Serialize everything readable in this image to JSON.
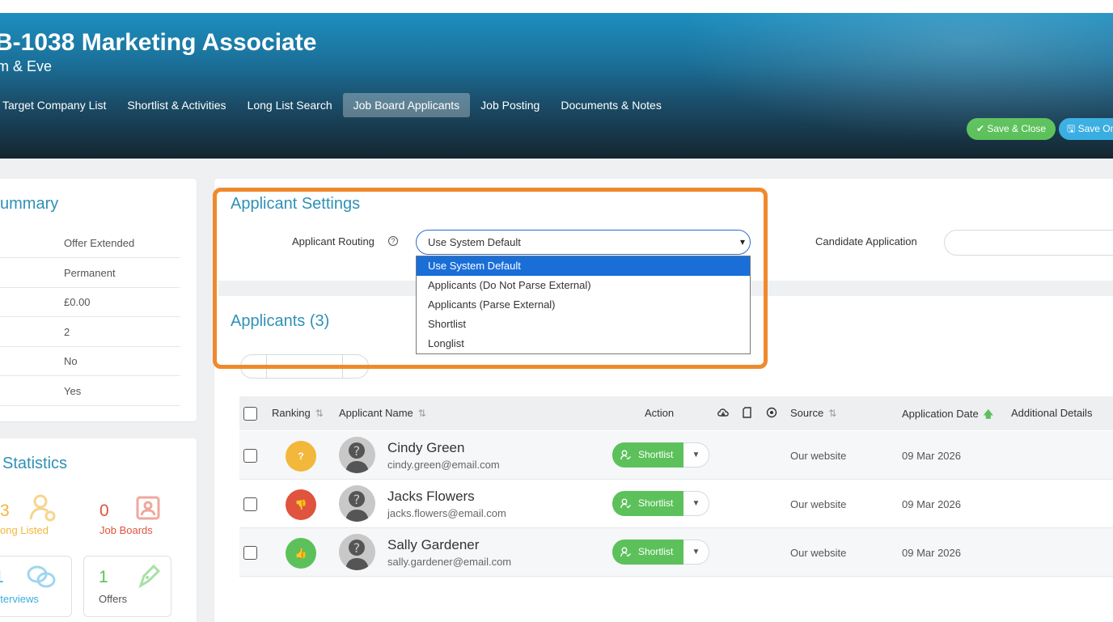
{
  "header": {
    "job_title": "B-1038 Marketing Associate",
    "company": "m & Eve",
    "tabs": [
      {
        "label": "Target Company List"
      },
      {
        "label": "Shortlist & Activities"
      },
      {
        "label": "Long List Search"
      },
      {
        "label": "Job Board Applicants",
        "active": true
      },
      {
        "label": "Job Posting"
      },
      {
        "label": "Documents & Notes"
      }
    ],
    "save_close_label": "Save & Close",
    "save_only_label": "Save On"
  },
  "summary": {
    "title": "ummary",
    "rows": [
      "Offer Extended",
      "Permanent",
      "£0.00",
      "2",
      "No",
      "Yes"
    ]
  },
  "statistics": {
    "title": "Statistics",
    "items": [
      {
        "value": "3",
        "label": "ong Listed",
        "color": "#f2b73b"
      },
      {
        "value": "0",
        "label": "Job Boards",
        "color": "#e0533f"
      },
      {
        "value": "1",
        "label": "nterviews",
        "color": "#3aaee2"
      },
      {
        "value": "1",
        "label": "Offers",
        "color": "#5cc15a"
      }
    ]
  },
  "applicant_settings": {
    "title": "Applicant Settings",
    "routing_label": "Applicant Routing",
    "routing_value": "Use System Default",
    "routing_options": [
      "Use System Default",
      "Applicants (Do Not Parse External)",
      "Applicants (Parse External)",
      "Shortlist",
      "Longlist"
    ],
    "candidate_application_label": "Candidate Application"
  },
  "applicants": {
    "title": "Applicants (3)",
    "columns": {
      "ranking": "Ranking",
      "name": "Applicant Name",
      "action": "Action",
      "source": "Source",
      "date": "Application Date",
      "details": "Additional Details"
    },
    "rows": [
      {
        "rank_symbol": "?",
        "rank_color": "#f2b73b",
        "name": "Cindy Green",
        "email": "cindy.green@email.com",
        "action": "Shortlist",
        "source": "Our website",
        "date": "09 Mar 2026"
      },
      {
        "rank_symbol": "👎",
        "rank_color": "#e0533f",
        "name": "Jacks Flowers",
        "email": "jacks.flowers@email.com",
        "action": "Shortlist",
        "source": "Our website",
        "date": "09 Mar 2026"
      },
      {
        "rank_symbol": "👍",
        "rank_color": "#5cc15a",
        "name": "Sally Gardener",
        "email": "sally.gardener@email.com",
        "action": "Shortlist",
        "source": "Our website",
        "date": "09 Mar 2026"
      }
    ]
  },
  "colors": {
    "accent": "#2f91b5",
    "highlight": "#ef8a2c",
    "green": "#5cc15a",
    "blue": "#3aaee2"
  }
}
